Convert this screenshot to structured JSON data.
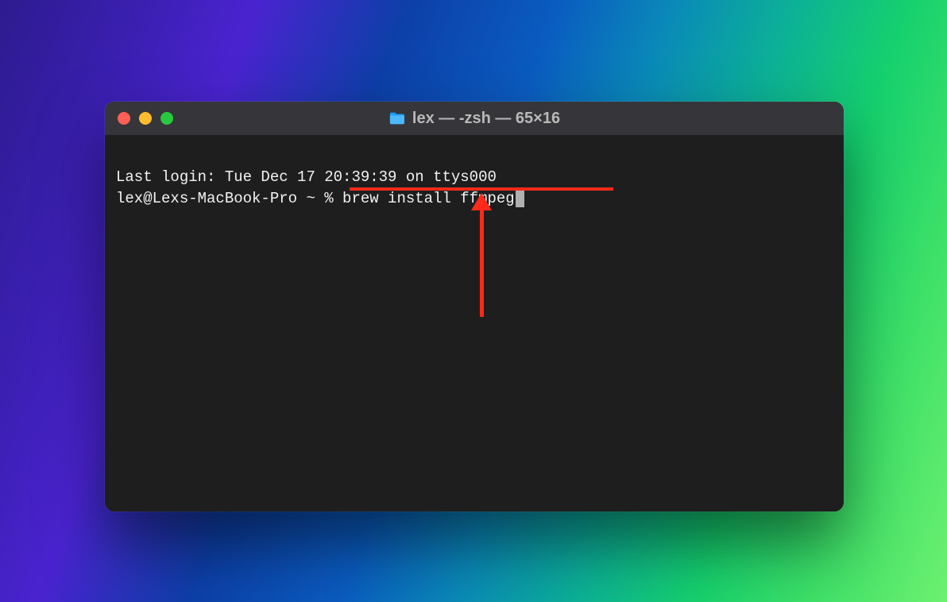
{
  "window": {
    "title": "lex — -zsh — 65×16",
    "traffic_lights": {
      "close": "close",
      "minimize": "minimize",
      "maximize": "maximize"
    },
    "folder_icon_color": "#1aa0ff"
  },
  "terminal": {
    "last_login_line": "Last login: Tue Dec 17 20:39:39 on ttys000",
    "prompt": "lex@Lexs-MacBook-Pro ~ % ",
    "command": "brew install ffmpeg"
  },
  "annotation": {
    "underline_color": "#ff2a1a",
    "arrow_color": "#ff2a1a"
  }
}
